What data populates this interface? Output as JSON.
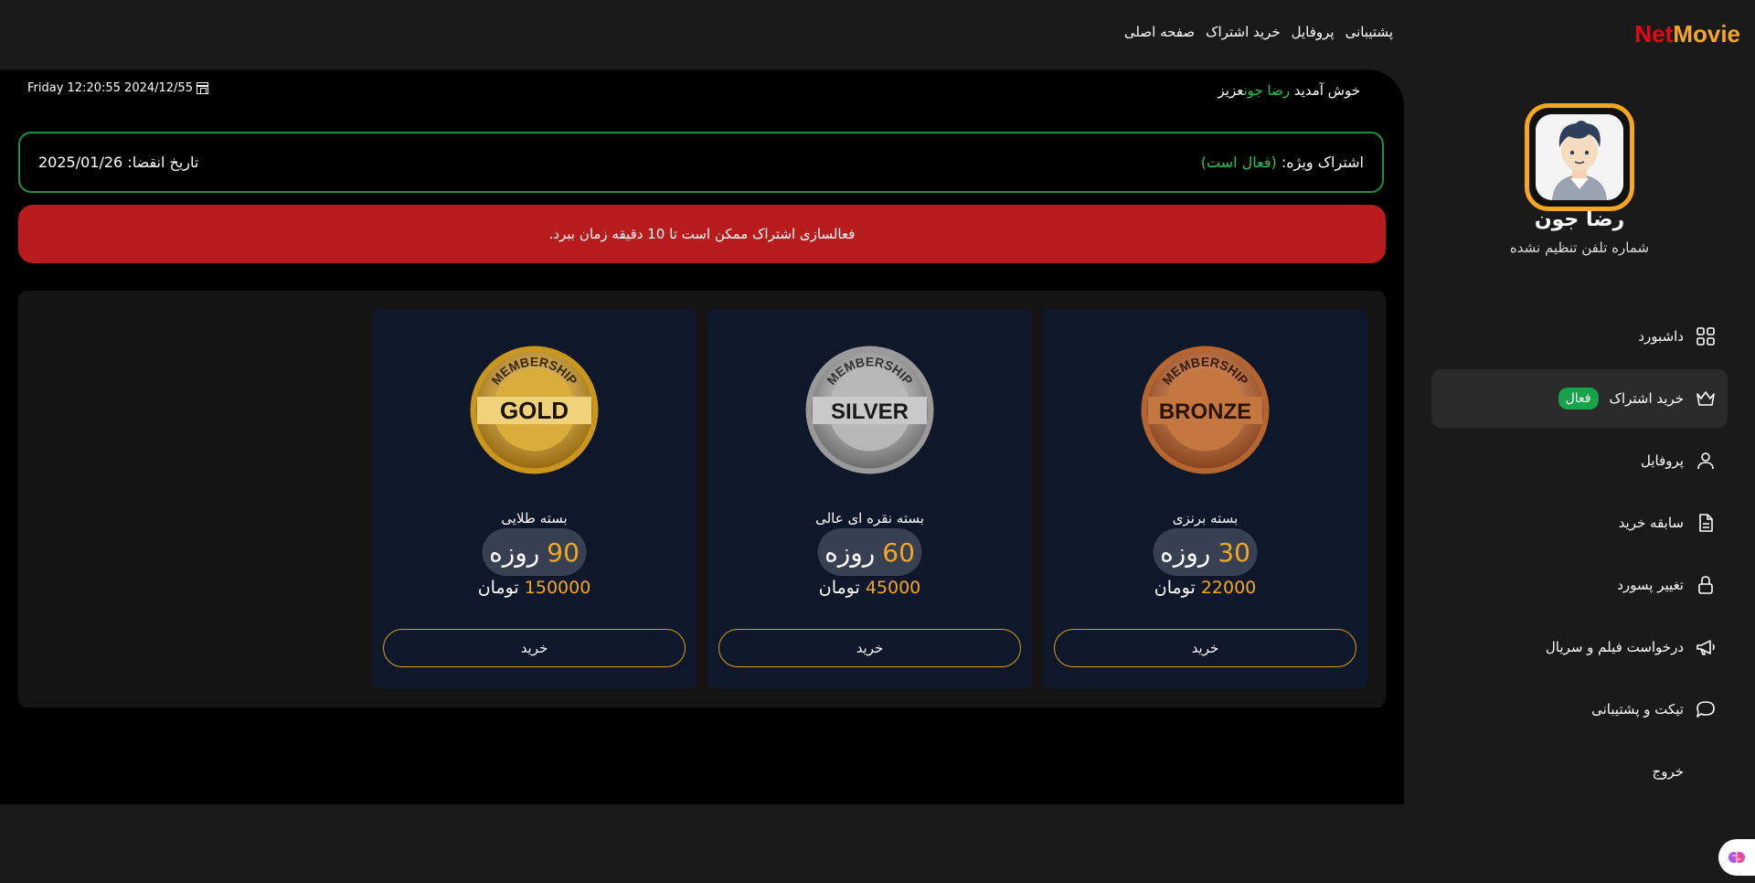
{
  "header": {
    "logo_net": "Net",
    "logo_movie": "Movie",
    "nav": [
      "صفحه اصلی",
      "خرید اشتراک",
      "پروفایل",
      "پشتیبانی"
    ],
    "colors": {
      "net": "#e50914",
      "movie": "#f5a623",
      "background": "#1a1a1a"
    }
  },
  "main": {
    "greeting_prefix": "خوش آمدید",
    "greeting_name": "رضا جون",
    "greeting_suffix": "عزیز",
    "datetime": "Friday 12:20:55 2024/12/55",
    "subscription_label": "اشتراک ویژه:",
    "subscription_status": "(فعال است)",
    "expiry": "تاریخ انقضا: 2025/01/26",
    "alert": "فعالسازی اشتراک ممکن است تا 10 دقیقه زمان ببرد.",
    "plans": [
      {
        "badge_text": "BRONZE",
        "badge_ring": "MEMBERSHIP",
        "badge_color": "#c2703d",
        "name": "بسته برنزی",
        "days": "30",
        "days_unit": "روزه",
        "price": "22000",
        "currency": "تومان",
        "buy_label": "خرید"
      },
      {
        "badge_text": "SILVER",
        "badge_ring": "MEMBERSHIP",
        "badge_color": "#a8a8a8",
        "name": "بسته نقره ای عالی",
        "days": "60",
        "days_unit": "روزه",
        "price": "45000",
        "currency": "تومان",
        "buy_label": "خرید"
      },
      {
        "badge_text": "GOLD",
        "badge_ring": "MEMBERSHIP",
        "badge_color": "#d4a52a",
        "name": "بسته طلایی",
        "days": "90",
        "days_unit": "روزه",
        "price": "150000",
        "currency": "تومان",
        "buy_label": "خرید"
      }
    ],
    "colors": {
      "alert": "#b91c1c",
      "accent_green": "#22c55e",
      "accent_orange": "#f5a623"
    }
  },
  "sidebar": {
    "name": "رضا جون",
    "phone": "شماره تلفن تنظیم نشده",
    "items": [
      {
        "label": "داشبورد",
        "icon": "grid-icon"
      },
      {
        "label": "خرید اشتراک",
        "icon": "crown-icon",
        "badge": "فعال",
        "active": true
      },
      {
        "label": "پروفایل",
        "icon": "user-icon"
      },
      {
        "label": "سابقه خرید",
        "icon": "document-icon"
      },
      {
        "label": "تغییر پسورد",
        "icon": "lock-icon"
      },
      {
        "label": "درخواست فیلم و سریال",
        "icon": "megaphone-icon"
      },
      {
        "label": "تیکت و پشتیبانی",
        "icon": "chat-bubble-icon"
      },
      {
        "label": "خروج",
        "icon": ""
      }
    ]
  }
}
